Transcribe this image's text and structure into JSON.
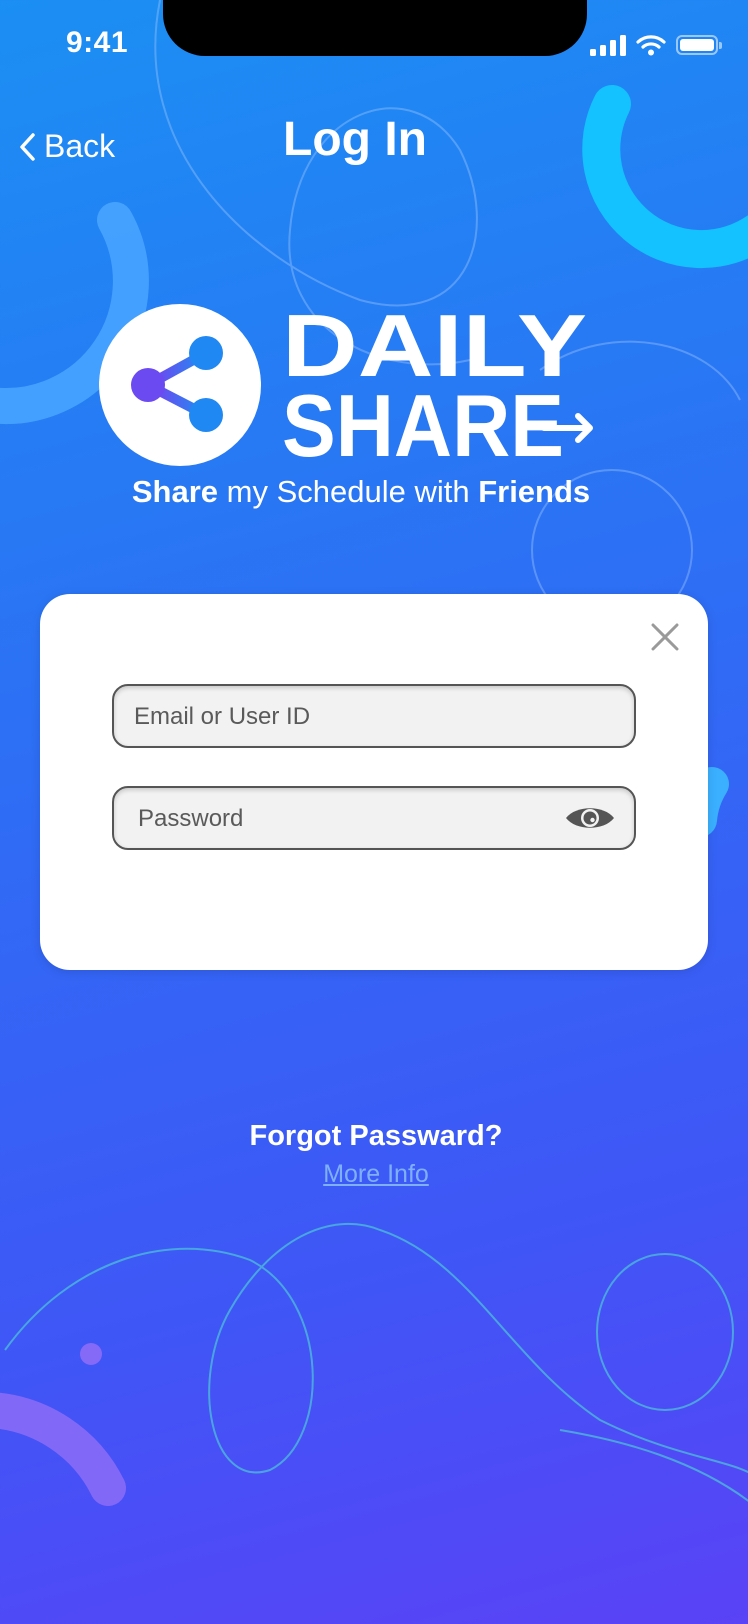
{
  "status_bar": {
    "time": "9:41"
  },
  "nav": {
    "back_label": "Back",
    "title": "Log In"
  },
  "brand": {
    "line1": "DAILY",
    "line2": "SHARE",
    "tagline_bold_1": "Share",
    "tagline_middle": " my Schedule with ",
    "tagline_bold_2": "Friends"
  },
  "login_form": {
    "email_placeholder": "Email or User ID",
    "email_value": "",
    "password_placeholder": "Password",
    "password_value": ""
  },
  "footer": {
    "forgot_label": "Forgot Passward?",
    "more_info_label": "More Info"
  },
  "icons": {
    "back": "chevron-left-icon",
    "close": "close-icon",
    "eye": "eye-icon",
    "share": "share-icon",
    "signal": "signal-icon",
    "wifi": "wifi-icon",
    "battery": "battery-icon"
  },
  "colors": {
    "gradient_top": "#1b8ff3",
    "gradient_bottom": "#5a42f6",
    "card": "#ffffff",
    "link": "#7fb0ff",
    "logo_accent_start": "#7b3cf0",
    "logo_accent_end": "#1e8ff2"
  }
}
